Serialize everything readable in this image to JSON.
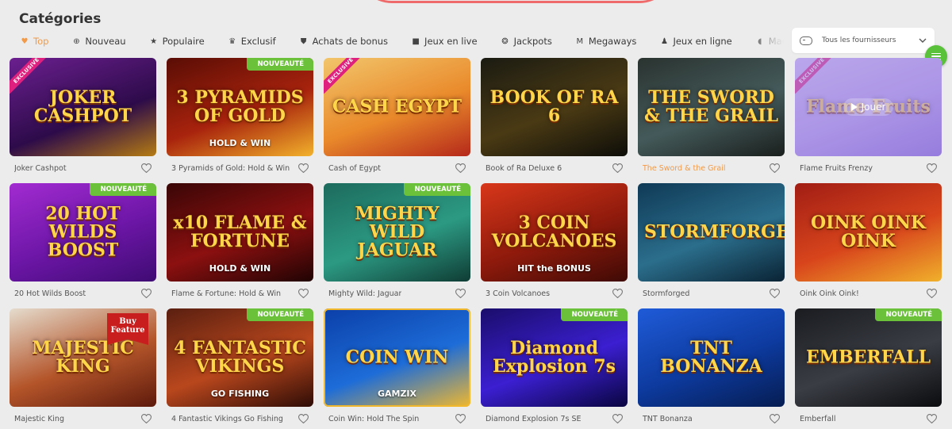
{
  "page": {
    "title": "Catégories"
  },
  "tabs": [
    {
      "label": "Top",
      "icon": "heart-icon",
      "glyph": "♥",
      "active": true
    },
    {
      "label": "Nouveau",
      "icon": "plus-circle-icon",
      "glyph": "⊕"
    },
    {
      "label": "Populaire",
      "icon": "star-icon",
      "glyph": "★"
    },
    {
      "label": "Exclusif",
      "icon": "crown-icon",
      "glyph": "♛"
    },
    {
      "label": "Achats de bonus",
      "icon": "shopping-bag-icon",
      "glyph": "⛊"
    },
    {
      "label": "Jeux en live",
      "icon": "video-camera-icon",
      "glyph": "■"
    },
    {
      "label": "Jackpots",
      "icon": "coin-icon",
      "glyph": "❂"
    },
    {
      "label": "Megaways",
      "icon": "megaways-m-icon",
      "glyph": "M"
    },
    {
      "label": "Jeux en ligne",
      "icon": "person-icon",
      "glyph": "♟"
    },
    {
      "label": "Mac",
      "icon": "leaf-icon",
      "glyph": "◖"
    }
  ],
  "provider_select": {
    "label": "Tous les fournisseurs",
    "icon": "gamepad-icon"
  },
  "chat": {
    "icon": "chat-icon",
    "color": "#59c23a"
  },
  "badges": {
    "new": "NOUVEAUTÉ",
    "exclusive": "EXCLUSIVE",
    "buy": "Buy Feature",
    "play": "Jouer"
  },
  "colors": {
    "accent": "#f29a48",
    "new_badge": "#6cc13b",
    "exclusive_badge": "#e0207e",
    "background": "#ececec"
  },
  "games": [
    {
      "name": "Joker Cashpot",
      "art": "JOKER CASHPOT",
      "bg": "linear-gradient(160deg,#6b1f8f,#2d0b4a 60%,#b57b12)",
      "exclusive": true
    },
    {
      "name": "3 Pyramids of Gold: Hold & Win",
      "art": "3 PYRAMIDS OF GOLD",
      "sub": "HOLD & WIN",
      "bg": "linear-gradient(160deg,#5a0d05,#a8230d 55%,#f2b12b)",
      "new": true
    },
    {
      "name": "Cash of Egypt",
      "art": "CASH EGYPT",
      "bg": "linear-gradient(160deg,#f2c56b,#e98a2b 55%,#b5281a)",
      "exclusive": true
    },
    {
      "name": "Book of Ra Deluxe 6",
      "art": "BOOK OF RA 6",
      "bg": "linear-gradient(160deg,#1b1b12,#4a3a14 55%,#0d0d08)"
    },
    {
      "name": "The Sword & the Grail",
      "art": "THE SWORD & THE GRAIL",
      "bg": "linear-gradient(160deg,#2a3330,#445a5a 55%,#1a1f1d)",
      "highlight": true
    },
    {
      "name": "Flame Fruits Frenzy",
      "art": "Flame Fruits",
      "bg": "linear-gradient(160deg,#d9c6f2,#b89fe6 55%,#8a6ad4)",
      "exclusive": true,
      "play": true
    },
    {
      "name": "20 Hot Wilds Boost",
      "art": "20 HOT WILDS BOOST",
      "bg": "linear-gradient(160deg,#a22bd1,#6c16a6 55%,#3f0b73)",
      "new": true
    },
    {
      "name": "Flame & Fortune: Hold & Win",
      "art": "x10 FLAME & FORTUNE",
      "sub": "HOLD & WIN",
      "bg": "linear-gradient(160deg,#3a0606,#8c1010 55%,#200303)"
    },
    {
      "name": "Mighty Wild: Jaguar",
      "art": "MIGHTY WILD JAGUAR",
      "bg": "linear-gradient(160deg,#1d6b5d,#2c9a83 55%,#0f3c34)",
      "new": true
    },
    {
      "name": "3 Coin Volcanoes",
      "art": "3 COIN VOLCANOES",
      "sub": "HIT the BONUS",
      "bg": "linear-gradient(160deg,#d8371a,#8e1a0c 55%,#3f0a05)"
    },
    {
      "name": "Stormforged",
      "art": "STORMFORGED",
      "bg": "linear-gradient(160deg,#0f3a56,#2b6e8c 55%,#0a2334)"
    },
    {
      "name": "Oink Oink Oink!",
      "art": "OINK OINK OINK",
      "bg": "linear-gradient(160deg,#a11d14,#d8451c 55%,#f0b02b)"
    },
    {
      "name": "Majestic King",
      "art": "MAJESTIC KING",
      "bg": "linear-gradient(160deg,#e5dccd,#b4552a 55%,#5e1a0c)",
      "buy": true
    },
    {
      "name": "4 Fantastic Vikings Go Fishing",
      "art": "4 FANTASTIC VIKINGS",
      "sub": "GO FISHING",
      "bg": "linear-gradient(160deg,#5a1f10,#b9471d 55%,#2e0c06)",
      "new": true
    },
    {
      "name": "Coin Win: Hold The Spin",
      "art": "COIN WIN",
      "sub": "GAMZIX",
      "bg": "linear-gradient(160deg,#0b3fa8,#1d6cd8 55%,#f1b82e)",
      "gold_frame": true
    },
    {
      "name": "Diamond Explosion 7s SE",
      "art": "Diamond Explosion 7s",
      "bg": "linear-gradient(160deg,#1a0d6b,#3b1fd1 55%,#0a0540)",
      "new": true
    },
    {
      "name": "TNT Bonanza",
      "art": "TNT BONANZA",
      "bg": "linear-gradient(160deg,#1f5bd8,#0d3a9e 55%,#061d52)"
    },
    {
      "name": "Emberfall",
      "art": "EMBERFALL",
      "bg": "linear-gradient(160deg,#1a1c20,#3a3d44 55%,#0b0c0e)",
      "new": true
    }
  ]
}
